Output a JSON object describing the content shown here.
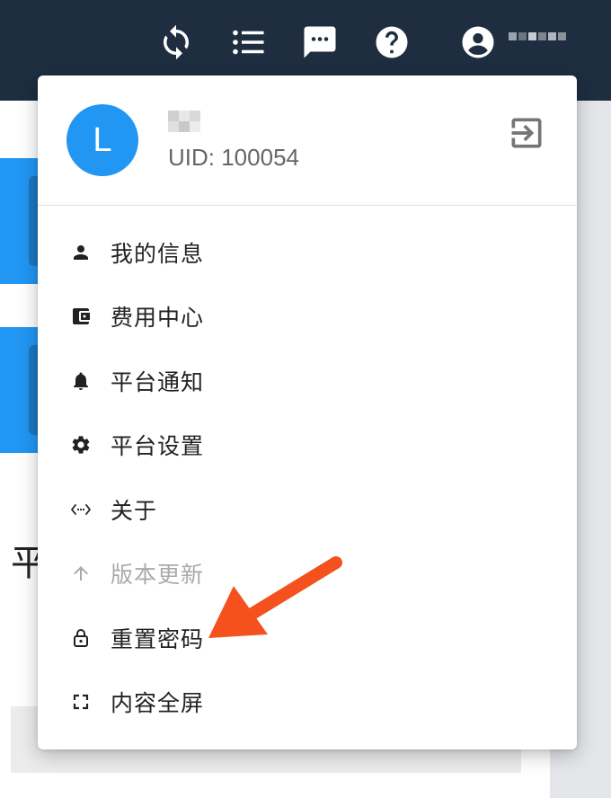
{
  "topbar": {
    "icons": [
      "sync-icon",
      "list-icon",
      "chat-icon",
      "help-icon",
      "account-icon"
    ],
    "bg_color": "#1e2d40",
    "username_colors": [
      "#9aa3ad",
      "#6b7480",
      "#c7ccd2",
      "#7d8690",
      "#b0b6bd",
      "#8a929b"
    ]
  },
  "background": {
    "glyph": "平"
  },
  "menu": {
    "avatar_letter": "L",
    "avatar_color": "#2196f3",
    "uid": "UID: 100054",
    "username_tiles": [
      "#cfcfcf",
      "#e7e7e7",
      "#d8d8d8",
      "#e0e0e0",
      "#c9c9c9",
      "#ececec"
    ],
    "items": [
      {
        "label": "我的信息",
        "icon": "person-icon",
        "disabled": false
      },
      {
        "label": "费用中心",
        "icon": "wallet-icon",
        "disabled": false
      },
      {
        "label": "平台通知",
        "icon": "bell-icon",
        "disabled": false
      },
      {
        "label": "平台设置",
        "icon": "gear-icon",
        "disabled": false
      },
      {
        "label": "关于",
        "icon": "code-icon",
        "disabled": false
      },
      {
        "label": "版本更新",
        "icon": "arrow-up-icon",
        "disabled": true
      },
      {
        "label": "重置密码",
        "icon": "lock-icon",
        "disabled": false
      },
      {
        "label": "内容全屏",
        "icon": "fullscreen-icon",
        "disabled": false
      }
    ]
  },
  "annotation": {
    "arrow_color": "#f4511e"
  }
}
